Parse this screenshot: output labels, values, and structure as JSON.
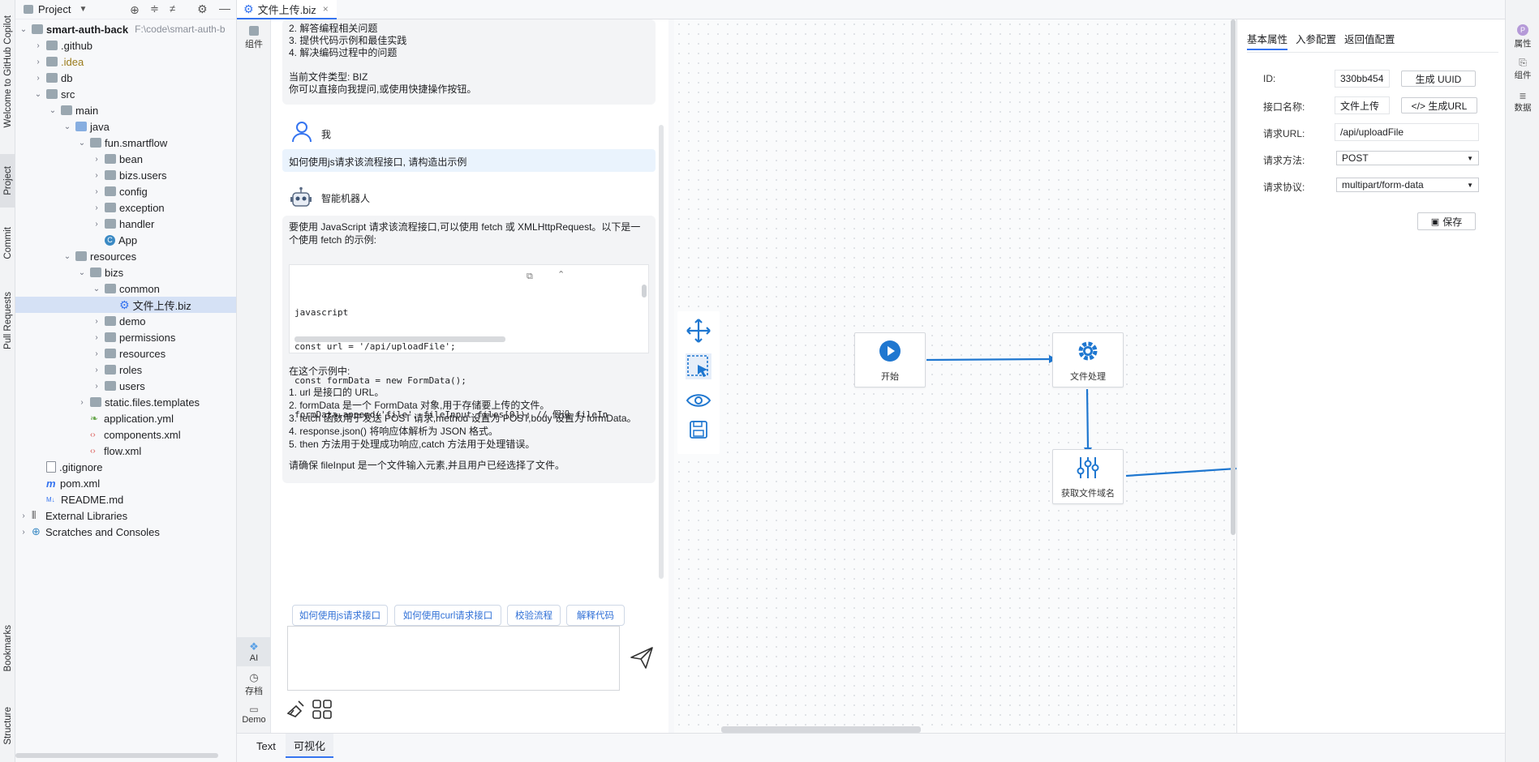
{
  "left_strip": {
    "tabs": [
      "Welcome to GitHub Copilot",
      "Project",
      "Commit",
      "Pull Requests",
      "Bookmarks",
      "Structure"
    ]
  },
  "project": {
    "title": "Project",
    "tree": [
      {
        "label": "smart-auth-back",
        "extra": "F:\\code\\smart-auth-b",
        "depth": 0,
        "arrow": "open",
        "icon": "folder",
        "bold": true
      },
      {
        "label": ".github",
        "depth": 1,
        "arrow": "closed",
        "icon": "folder"
      },
      {
        "label": ".idea",
        "depth": 1,
        "arrow": "closed",
        "icon": "folder",
        "color": "#9a7a1a"
      },
      {
        "label": "db",
        "depth": 1,
        "arrow": "closed",
        "icon": "folder"
      },
      {
        "label": "src",
        "depth": 1,
        "arrow": "open",
        "icon": "folder"
      },
      {
        "label": "main",
        "depth": 2,
        "arrow": "open",
        "icon": "folder"
      },
      {
        "label": "java",
        "depth": 3,
        "arrow": "open",
        "icon": "folder-blue"
      },
      {
        "label": "fun.smartflow",
        "depth": 4,
        "arrow": "open",
        "icon": "folder"
      },
      {
        "label": "bean",
        "depth": 5,
        "arrow": "closed",
        "icon": "folder"
      },
      {
        "label": "bizs.users",
        "depth": 5,
        "arrow": "closed",
        "icon": "folder"
      },
      {
        "label": "config",
        "depth": 5,
        "arrow": "closed",
        "icon": "folder"
      },
      {
        "label": "exception",
        "depth": 5,
        "arrow": "closed",
        "icon": "folder"
      },
      {
        "label": "handler",
        "depth": 5,
        "arrow": "closed",
        "icon": "folder"
      },
      {
        "label": "App",
        "depth": 5,
        "arrow": "none",
        "icon": "class"
      },
      {
        "label": "resources",
        "depth": 3,
        "arrow": "open",
        "icon": "folder"
      },
      {
        "label": "bizs",
        "depth": 4,
        "arrow": "open",
        "icon": "folder"
      },
      {
        "label": "common",
        "depth": 5,
        "arrow": "open",
        "icon": "folder"
      },
      {
        "label": "文件上传.biz",
        "depth": 6,
        "arrow": "none",
        "icon": "gear",
        "selected": true
      },
      {
        "label": "demo",
        "depth": 5,
        "arrow": "closed",
        "icon": "folder"
      },
      {
        "label": "permissions",
        "depth": 5,
        "arrow": "closed",
        "icon": "folder"
      },
      {
        "label": "resources",
        "depth": 5,
        "arrow": "closed",
        "icon": "folder"
      },
      {
        "label": "roles",
        "depth": 5,
        "arrow": "closed",
        "icon": "folder"
      },
      {
        "label": "users",
        "depth": 5,
        "arrow": "closed",
        "icon": "folder"
      },
      {
        "label": "static.files.templates",
        "depth": 4,
        "arrow": "closed",
        "icon": "folder"
      },
      {
        "label": "application.yml",
        "depth": 4,
        "arrow": "none",
        "icon": "yml"
      },
      {
        "label": "components.xml",
        "depth": 4,
        "arrow": "none",
        "icon": "xml"
      },
      {
        "label": "flow.xml",
        "depth": 4,
        "arrow": "none",
        "icon": "xml"
      },
      {
        "label": ".gitignore",
        "depth": 1,
        "arrow": "none",
        "icon": "file"
      },
      {
        "label": "pom.xml",
        "depth": 1,
        "arrow": "none",
        "icon": "maven"
      },
      {
        "label": "README.md",
        "depth": 1,
        "arrow": "none",
        "icon": "md"
      },
      {
        "label": "External Libraries",
        "depth": 0,
        "arrow": "closed",
        "icon": "lib"
      },
      {
        "label": "Scratches and Consoles",
        "depth": 0,
        "arrow": "closed",
        "icon": "scratch"
      }
    ]
  },
  "editor": {
    "tab_label": "文件上传.biz"
  },
  "inner_strip": {
    "component": "组件",
    "ai": "AI",
    "save": "存档",
    "demo": "Demo"
  },
  "chat": {
    "intro_lines": [
      "2. 解答编程相关问题",
      "3. 提供代码示例和最佳实践",
      "4. 解决编码过程中的问题"
    ],
    "file_type_line": "当前文件类型: BIZ",
    "prompt_line": "你可以直接向我提问,或使用快捷操作按钮。",
    "user_name": "我",
    "user_message": "如何使用js请求该流程接口, 请构造出示例",
    "bot_name": "智能机器人",
    "answer_intro": "要使用 JavaScript 请求该流程接口,可以使用 fetch 或 XMLHttpRequest。以下是一个使用 fetch 的示例:",
    "code_lines": [
      "javascript",
      "const url = '/api/uploadFile';",
      "const formData = new FormData();",
      "formData.append('file', fileInput.files[0]); // 假设 fileIn"
    ],
    "explain_title": "在这个示例中:",
    "explain_items": [
      "1. url 是接口的 URL。",
      "2. formData 是一个 FormData 对象,用于存储要上传的文件。",
      "3. fetch 函数用于发送 POST 请求,method 设置为 POST,body 设置为 formData。",
      "4. response.json() 将响应体解析为 JSON 格式。",
      "5. then 方法用于处理成功响应,catch 方法用于处理错误。"
    ],
    "closing": "请确保 fileInput 是一个文件输入元素,并且用户已经选择了文件。",
    "quick_actions": [
      "如何使用js请求接口",
      "如何使用curl请求接口",
      "校验流程",
      "解释代码"
    ],
    "input_placeholder": ""
  },
  "canvas": {
    "nodes": {
      "start": "开始",
      "process": "文件处理",
      "filename": "获取文件域名"
    },
    "colors": {
      "accent": "#1f77d0"
    }
  },
  "props": {
    "tabs": [
      "基本属性",
      "入参配置",
      "返回值配置"
    ],
    "id_label": "ID:",
    "id_value": "330bb454",
    "gen_uuid": "生成 UUID",
    "name_label": "接口名称:",
    "name_value": "文件上传",
    "gen_url": "</> 生成URL",
    "url_label": "请求URL:",
    "url_value": "/api/uploadFile",
    "method_label": "请求方法:",
    "method_value": "POST",
    "protocol_label": "请求协议:",
    "protocol_value": "multipart/form-data",
    "save": "保存"
  },
  "right_strip": {
    "props": "属性",
    "component": "组件",
    "data": "数据"
  },
  "bottom_tabs": [
    "Text",
    "可视化"
  ]
}
